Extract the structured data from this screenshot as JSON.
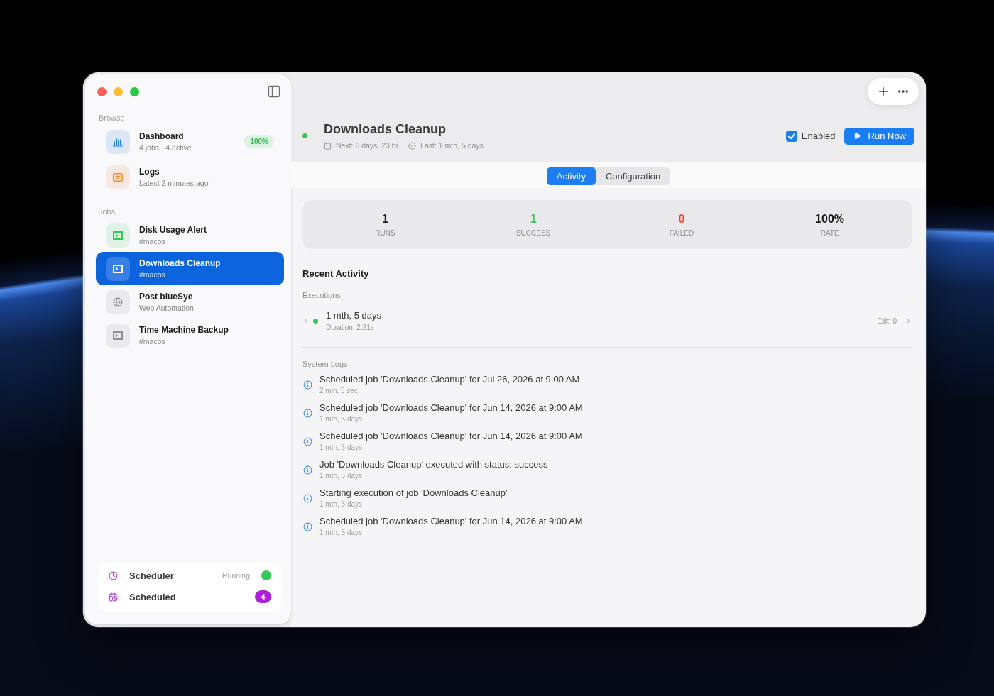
{
  "sidebar": {
    "sections": [
      {
        "title": "Browse",
        "items": [
          {
            "kind": "dashboard",
            "title": "Dashboard",
            "subtitle": "4 jobs · 4 active",
            "badge": "100%",
            "color": "#1f7ae0",
            "selected": false
          },
          {
            "kind": "logs",
            "title": "Logs",
            "subtitle": "Latest 2 minutes ago",
            "color": "#ef8a2e",
            "selected": false
          }
        ]
      },
      {
        "title": "Jobs",
        "items": [
          {
            "kind": "shell",
            "title": "Disk Usage Alert",
            "subtitle": "#macos",
            "color": "#34c759",
            "selected": false
          },
          {
            "kind": "shell",
            "title": "Downloads Cleanup",
            "subtitle": "#macos",
            "selected": true
          },
          {
            "kind": "web",
            "title": "Post blueSye",
            "subtitle": "Web Automation",
            "color": "#8e8e93",
            "selected": false
          },
          {
            "kind": "shell",
            "title": "Time Machine Backup",
            "subtitle": "#macos",
            "color": "#8e8e93",
            "selected": false
          }
        ]
      }
    ],
    "status_card": [
      {
        "kind": "status",
        "label": "Scheduler",
        "status": "Running",
        "on": true
      },
      {
        "kind": "count",
        "label": "Scheduled",
        "count": "4"
      }
    ]
  },
  "job": {
    "title": "Downloads Cleanup",
    "active": true,
    "next": "Next: 6 days, 23 hr",
    "last": "Last: 1 mth, 5 days",
    "enabled": {
      "label": "Enabled",
      "checked": true
    },
    "run_button": "Run Now"
  },
  "tabs": [
    {
      "label": "Activity",
      "selected": true
    },
    {
      "label": "Configuration",
      "selected": false
    }
  ],
  "stats": [
    {
      "value": "1",
      "label": "RUNS",
      "color": "#1d1d1f"
    },
    {
      "value": "1",
      "label": "SUCCESS",
      "color": "#34c759"
    },
    {
      "value": "0",
      "label": "FAILED",
      "color": "#ff3b30"
    },
    {
      "value": "100%",
      "label": "RATE",
      "color": "#1d1d1f"
    }
  ],
  "recent_activity": {
    "title": "Recent Activity",
    "executions": {
      "label": "Executions",
      "rows": [
        {
          "time": "1 mth, 5 days",
          "duration": "Duration: 2.21s",
          "exit": "Exit: 0",
          "color": "#34c759",
          "expanded": false
        }
      ]
    },
    "system_logs": {
      "label": "System Logs",
      "entries": [
        {
          "message": "Scheduled job 'Downloads Cleanup' for Jul 26, 2026 at 9:00 AM",
          "time": "2 min, 5 sec"
        },
        {
          "message": "Scheduled job 'Downloads Cleanup' for Jun 14, 2026 at 9:00 AM",
          "time": "1 mth, 5 days"
        },
        {
          "message": "Scheduled job 'Downloads Cleanup' for Jun 14, 2026 at 9:00 AM",
          "time": "1 mth, 5 days"
        },
        {
          "message": "Job 'Downloads Cleanup' executed with status: success",
          "time": "1 mth, 5 days"
        },
        {
          "message": "Starting execution of job 'Downloads Cleanup'",
          "time": "1 mth, 5 days"
        },
        {
          "message": "Scheduled job 'Downloads Cleanup' for Jun 14, 2026 at 9:00 AM",
          "time": "1 mth, 5 days"
        }
      ]
    }
  }
}
